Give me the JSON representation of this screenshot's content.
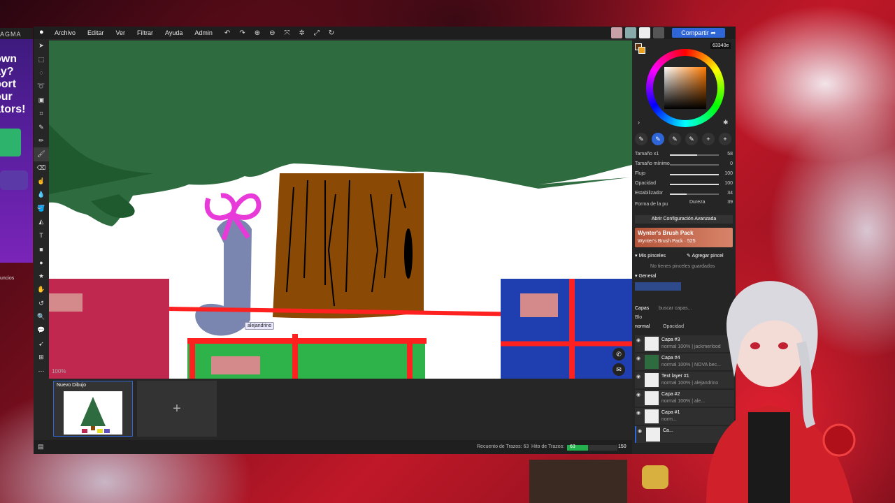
{
  "menu": {
    "items": [
      "Archivo",
      "Editar",
      "Ver",
      "Filtrar",
      "Ayuda",
      "Admin"
    ]
  },
  "share_label": "Compartir",
  "color_hex": "63340e",
  "brush_sliders": [
    {
      "label": "Tamaño x1",
      "value": "58",
      "fraction": 0.55
    },
    {
      "label": "Tamaño mínimo",
      "value": "0",
      "fraction": 0.0
    },
    {
      "label": "Flujo",
      "value": "100",
      "fraction": 1.0
    },
    {
      "label": "Opacidad",
      "value": "100",
      "fraction": 1.0
    },
    {
      "label": "Estabilizador",
      "value": "34",
      "fraction": 0.34
    }
  ],
  "brush_shape_label": "Forma de la pu",
  "hardness": {
    "label": "Dureza",
    "value": "39"
  },
  "advanced_button": "Abrir Configuración Avanzada",
  "brush_pack": {
    "title": "Wynter's Brush Pack",
    "subtitle": "Wynter's Brush Pack · 525"
  },
  "my_brushes": {
    "label": "Mis pinceles",
    "add": "Agregar pincel",
    "empty": "No tienes pinceles guardados"
  },
  "general_label": "General",
  "layers": {
    "title": "Capas",
    "search_placeholder": "buscar capas...",
    "blend_label": "Blo",
    "blend_mode": "normal",
    "opacity_label": "Opacidad",
    "items": [
      {
        "name": "Capa #3",
        "sub": "normal 100% | jackmerlood"
      },
      {
        "name": "Capa #4",
        "sub": "normal 100% | NOVA bec..."
      },
      {
        "name": "Text layer #1",
        "sub": "normal 100% | alejandrino"
      },
      {
        "name": "Capa #2",
        "sub": "normal 100% | ale..."
      },
      {
        "name": "Capa #1",
        "sub": "norm..."
      },
      {
        "name": "Ca...",
        "sub": ""
      }
    ]
  },
  "canvas": {
    "zoom": "100%",
    "cursor_user": "alejandrino"
  },
  "thumbnail": {
    "title": "Nuevo Dibujo"
  },
  "status": {
    "label_strokes": "Recuento de Trazos: 63",
    "label_goal": "Hito de Trazos:",
    "strokes": 63,
    "goal": 150,
    "progress": 0.42
  },
  "ad": {
    "brand": "AGMA",
    "headline": "own ay? port our ators!",
    "links": "uncios"
  }
}
